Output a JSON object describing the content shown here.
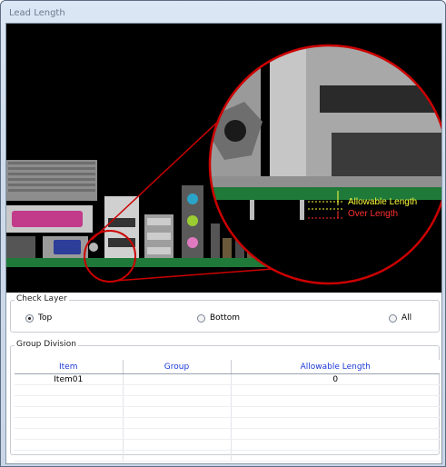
{
  "window": {
    "title": "Lead Length"
  },
  "preview": {
    "allowable_label": "Allowable Length",
    "over_label": "Over Length",
    "colors": {
      "allowable": "#ffff3c",
      "over": "#ff3030",
      "board": "#1f7a3a",
      "zoom_ring": "#cc0000"
    }
  },
  "check_layer": {
    "legend": "Check Layer",
    "options": [
      {
        "label": "Top",
        "selected": true
      },
      {
        "label": "Bottom",
        "selected": false
      },
      {
        "label": "All",
        "selected": false
      }
    ]
  },
  "group_division": {
    "legend": "Group Division",
    "columns": [
      "Item",
      "Group",
      "Allowable Length"
    ],
    "rows": [
      [
        "Item01",
        "",
        "0"
      ]
    ]
  }
}
